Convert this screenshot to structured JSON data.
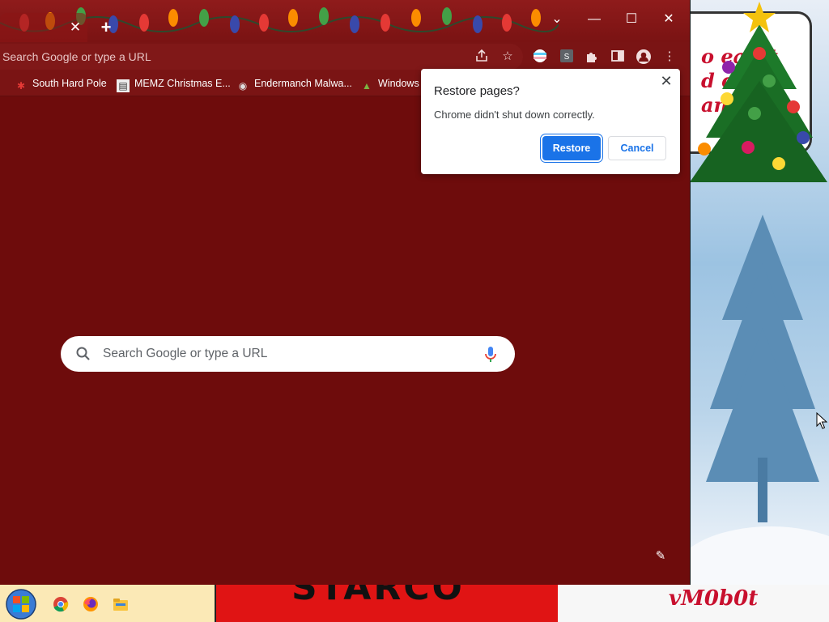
{
  "browser": {
    "tab": {
      "close_symbol": "✕"
    },
    "new_tab_symbol": "+",
    "window_controls": {
      "tab_search": "⌄",
      "minimize": "—",
      "maximize": "☐",
      "close": "✕"
    },
    "omnibox": {
      "placeholder": "Search Google or type a URL"
    },
    "toolbar_icons": [
      "share-icon",
      "star-icon",
      "flag-extension-icon",
      "s-extension-icon",
      "puzzle-extensions-icon",
      "side-panel-icon",
      "profile-icon",
      "menu-icon"
    ],
    "toolbar_s_label": "S"
  },
  "bookmarks": [
    {
      "label": "South Hard Pole",
      "icon": "snowflake-icon"
    },
    {
      "label": "MEMZ Christmas E...",
      "icon": "page-thumbnail-icon"
    },
    {
      "label": "Endermanch Malwa...",
      "icon": "raccoon-icon"
    },
    {
      "label": "Windows",
      "icon": "tree-icon"
    }
  ],
  "ntp": {
    "search_placeholder": "Search Google or type a URL",
    "customize_icon": "pencil-icon"
  },
  "dialog": {
    "title": "Restore pages?",
    "message": "Chrome didn't shut down correctly.",
    "restore_label": "Restore",
    "cancel_label": "Cancel",
    "close_symbol": "✕"
  },
  "wallpaper": {
    "note_text": "o eat it\nd c\nan",
    "signature": "vM0b0t",
    "banner_text": "STARCO"
  },
  "taskbar": {
    "apps": [
      "start-orb-icon",
      "chrome-icon",
      "firefox-icon",
      "file-explorer-icon"
    ]
  },
  "colors": {
    "theme_red": "#6e0c0c",
    "accent_blue": "#1a73e8"
  }
}
